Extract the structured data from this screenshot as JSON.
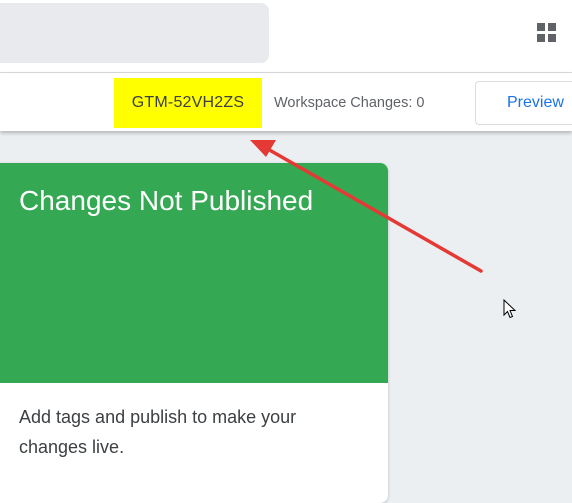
{
  "header": {
    "container_id": "GTM-52VH2ZS",
    "workspace_changes_label": "Workspace Changes:",
    "workspace_changes_count": "0",
    "preview_label": "Preview"
  },
  "card": {
    "title": "Changes Not Published",
    "body": "Add tags and publish to make your changes live."
  },
  "icons": {
    "apps": "apps-grid-icon",
    "cursor": "mouse-pointer-icon",
    "arrow": "red-arrow-annotation"
  },
  "colors": {
    "highlight": "#ffff00",
    "card_header": "#34a853",
    "accent": "#1a73e8",
    "annotation": "#e53935"
  }
}
